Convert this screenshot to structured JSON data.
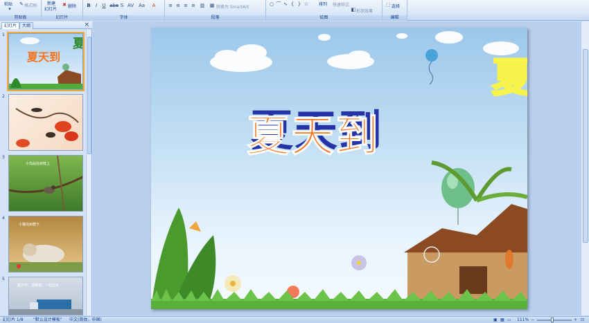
{
  "ribbon": {
    "clipboard": {
      "paste": "粘贴",
      "format_painter": "格式刷",
      "label": "剪贴板"
    },
    "slides": {
      "new_slide_line1": "新建",
      "new_slide_line2": "幻灯片",
      "delete": "删除",
      "label": "幻灯片"
    },
    "font": {
      "label": "字体"
    },
    "paragraph": {
      "convert_smartart": "转换为 SmartArt",
      "label": "段落"
    },
    "drawing": {
      "arrange": "排列",
      "quick_styles": "快速样式",
      "shape_effects": "形状效果",
      "label": "绘图"
    },
    "editing": {
      "select": "选择",
      "label": "编辑"
    }
  },
  "panel": {
    "tab_slides": "幻灯片",
    "tab_outline": "大纲",
    "close": "×",
    "thumbnails": [
      {
        "num": "1",
        "title": "夏天到"
      },
      {
        "num": "2",
        "caption": ""
      },
      {
        "num": "3",
        "caption": "小鸟站在树枝上"
      },
      {
        "num": "4",
        "caption": "小猫在树荫下"
      },
      {
        "num": "5",
        "caption": "夏天中，烟雾蒸，一起玩水"
      }
    ]
  },
  "slide": {
    "title": "夏天到"
  },
  "status": {
    "slide_info": "幻灯片 1/8",
    "theme": "\"默认设计模板\"",
    "language": "中文(简体，中国)",
    "zoom": "111%"
  },
  "colors": {
    "title_orange": "#f5731a",
    "title_shadow": "#2633a7",
    "ribbon_bg": "#d7e6f8"
  }
}
